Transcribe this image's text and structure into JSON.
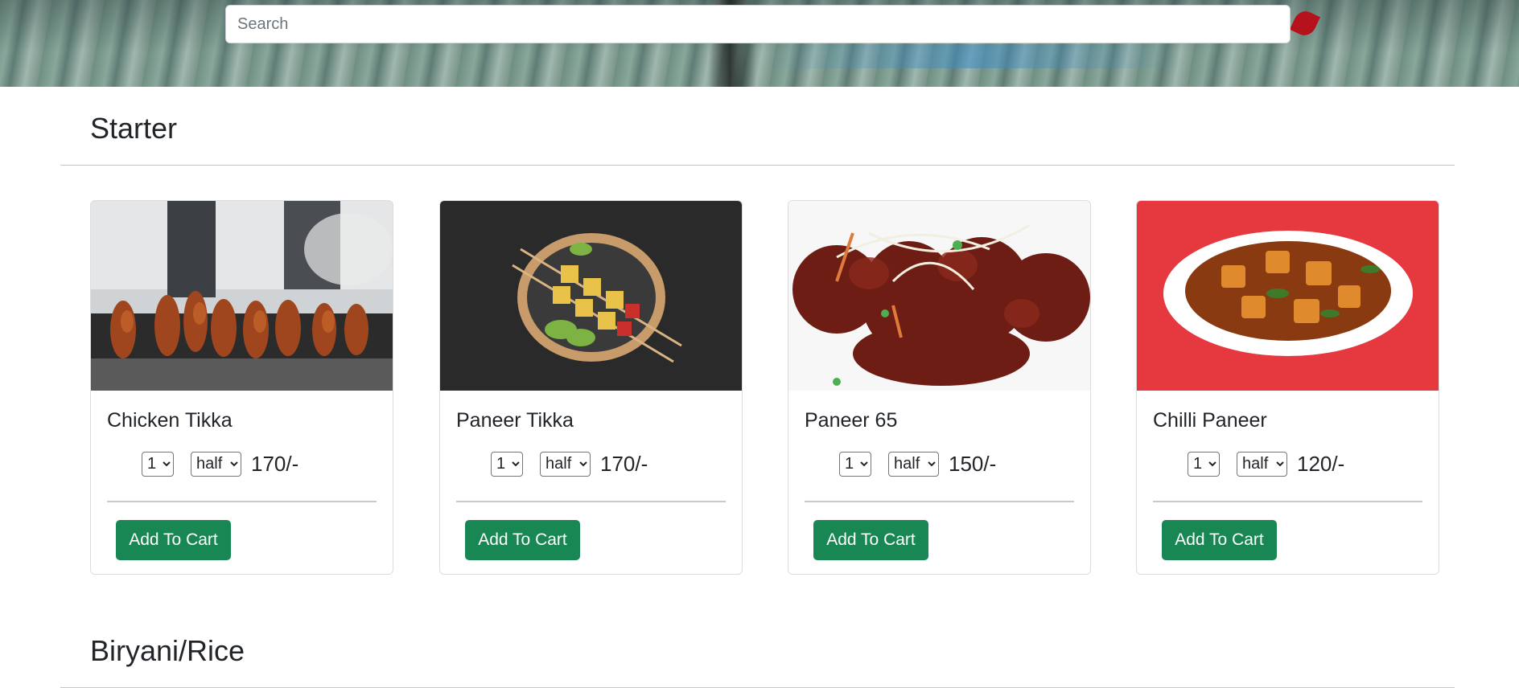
{
  "search": {
    "placeholder": "Search",
    "value": ""
  },
  "sections": [
    {
      "title": "Starter",
      "items": [
        {
          "name": "Chicken Tikka",
          "qty": "1",
          "size": "half",
          "price": "170/-",
          "button": "Add To Cart"
        },
        {
          "name": "Paneer Tikka",
          "qty": "1",
          "size": "half",
          "price": "170/-",
          "button": "Add To Cart"
        },
        {
          "name": "Paneer 65",
          "qty": "1",
          "size": "half",
          "price": "150/-",
          "button": "Add To Cart"
        },
        {
          "name": "Chilli Paneer",
          "qty": "1",
          "size": "half",
          "price": "120/-",
          "button": "Add To Cart"
        }
      ]
    },
    {
      "title": "Biryani/Rice"
    }
  ],
  "colors": {
    "button": "#198754",
    "divider": "#c8c8c8",
    "text": "#212529"
  }
}
